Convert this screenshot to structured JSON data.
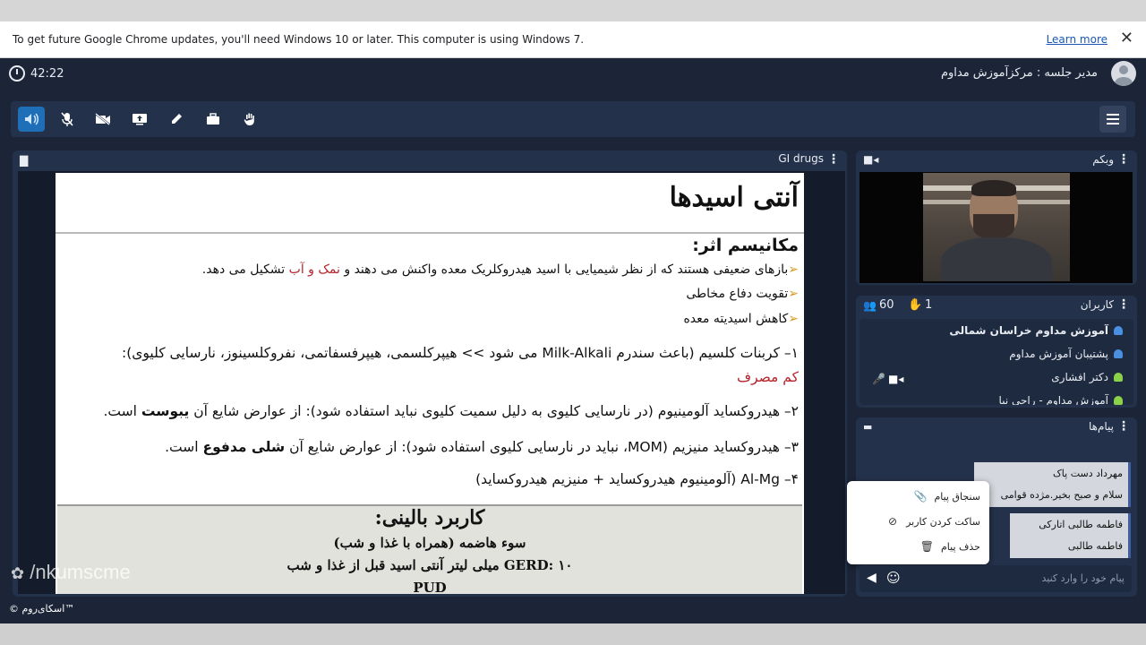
{
  "infobar": {
    "message": "To get future Google Chrome updates, you'll need Windows 10 or later. This computer is using Windows 7.",
    "learn_more": "Learn more",
    "close": "✕"
  },
  "header": {
    "timer": "42:22",
    "host_label": "مدیر جلسه : مرکزآموزش مداوم"
  },
  "toolbar": {
    "icons": [
      "speaker-icon",
      "mic-off-icon",
      "camera-off-icon",
      "screen-share-icon",
      "pen-icon",
      "briefcase-icon",
      "raise-hand-icon"
    ]
  },
  "slide_panel": {
    "title": "GI drugs",
    "slide": {
      "title": "آنتی اسیدها",
      "mechanism_heading": "مکانیسم اثر:",
      "bullet1_a": "بازهای ضعیفی هستند که از نظر شیمیایی با اسید هیدروکلریک معده واکنش می دهند و ",
      "bullet1_red": "نمک و آب",
      "bullet1_b": " تشکیل می دهد.",
      "bullet2": "تقویت دفاع مخاطی",
      "bullet3": "کاهش اسیدیته معده",
      "item1": "۱– کربنات کلسیم (باعث سندرم Milk-Alkali می شود >> هیپرکلسمی، هیپرفسفاتمی، نفروکلسینوز، نارسایی کلیوی):",
      "item1_red": "کم مصرف",
      "item2_a": "۲– هیدروکساید آلومینیوم (در نارسایی کلیوی به دلیل سمیت کلیوی نباید استفاده شود): از عوارض شایع آن ",
      "item2_bold": "یبوست",
      "item2_b": " است.",
      "item3_a": "۳– هیدروکساید منیزیم (MOM، نباید در نارسایی کلیوی استفاده شود): از عوارض شایع آن ",
      "item3_bold": "شلی مدفوع",
      "item3_b": " است.",
      "item4": "۴– Al-Mg (آلومینیوم هیدروکساید + منیزیم هیدروکساید)",
      "clinical_heading": "کاربرد بالینی:",
      "clinical1": "سوء هاضمه (همراه با غذا و شب)",
      "clinical2": "GERD: ۱۰ میلی لیتر آنتی اسید قبل از غذا و شب",
      "clinical3": "PUD"
    }
  },
  "watermark": "/nkumscme",
  "brand": "© اسکای‌روم™",
  "webcam": {
    "title": "وبکم"
  },
  "users": {
    "title": "کاربران",
    "count": "60",
    "hands": "1",
    "list": [
      {
        "name": "آموزش مداوم خراسان شمالی",
        "color": "#4a8fe0"
      },
      {
        "name": "پشتیبان آموزش مداوم",
        "color": "#4a8fe0"
      },
      {
        "name": "دکتر افشاری",
        "color": "#8bd14a"
      },
      {
        "name": "آموزش مداوم - راحی نیا",
        "color": "#8bd14a"
      }
    ]
  },
  "chat": {
    "title": "پیام‌ها",
    "messages": [
      {
        "sender": "مهرداد دست پاک",
        "text": "سلام و صبح بخیر.مژده قوامی"
      },
      {
        "sender": "فاطمه طالبی اتارکی",
        "text": "فاطمه طالبی"
      }
    ],
    "menu": [
      {
        "label": "سنجاق پیام",
        "icon": "pin-icon"
      },
      {
        "label": "ساکت کردن کاربر",
        "icon": "mute-user-icon"
      },
      {
        "label": "حذف پیام",
        "icon": "trash-icon"
      }
    ],
    "input_placeholder": "پیام خود را وارد کنید"
  }
}
